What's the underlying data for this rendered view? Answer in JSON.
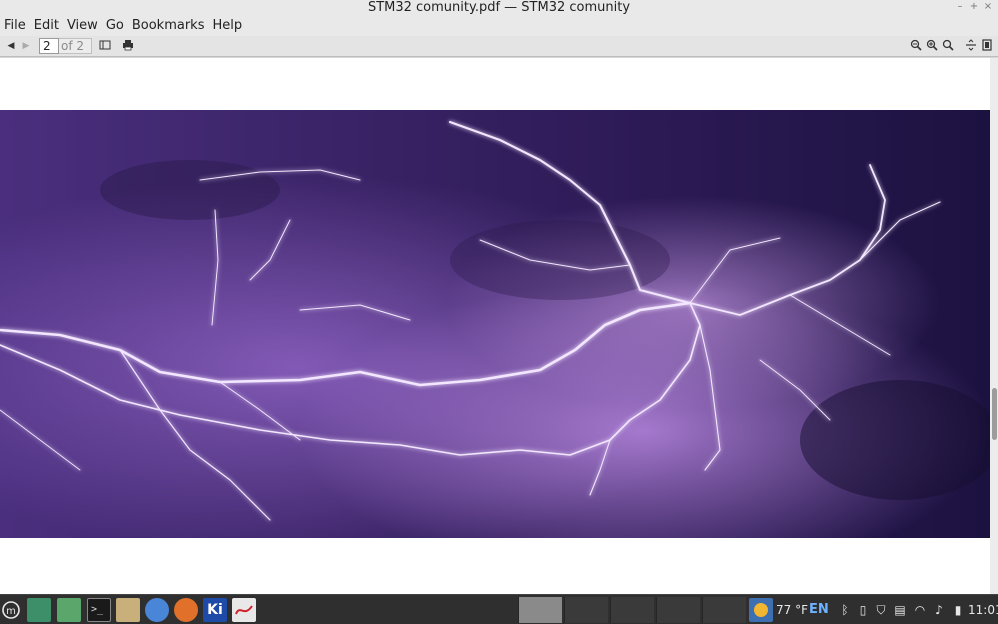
{
  "window": {
    "title": "STM32 comunity.pdf — STM32 comunity",
    "controls": {
      "minimize": "–",
      "maximize": "+",
      "close": "×"
    }
  },
  "menu": [
    "File",
    "Edit",
    "View",
    "Go",
    "Bookmarks",
    "Help"
  ],
  "toolbar": {
    "page_current": "2",
    "page_total_label": "of 2"
  },
  "taskbar": {
    "weather_temp": "77 °F",
    "language": "EN",
    "clock": "11:01",
    "colors": {
      "background": "#2f2f2f"
    }
  },
  "document": {
    "image_subject": "purple lightning storm",
    "scroll_position": 0.62
  }
}
